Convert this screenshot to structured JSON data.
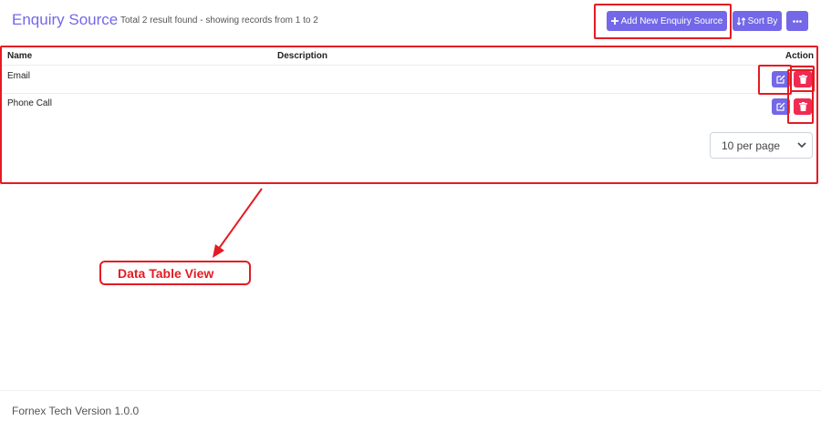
{
  "header": {
    "title": "Enquiry Source",
    "summary": "Total 2 result found - showing records from 1 to 2",
    "add_button": "Add New Enquiry Source",
    "sort_button": "Sort By"
  },
  "table": {
    "columns": [
      "Name",
      "Description",
      "Action"
    ],
    "rows": [
      {
        "name": "Email",
        "description": ""
      },
      {
        "name": "Phone Call",
        "description": ""
      }
    ]
  },
  "pagination": {
    "per_page": "10 per page"
  },
  "annotation": {
    "callout": "Data Table View"
  },
  "footer": {
    "version": "Fornex Tech Version 1.0.0"
  },
  "colors": {
    "accent": "#7468e8",
    "danger": "#f02b53",
    "annotation": "#e41b23"
  },
  "icons": [
    "plus-icon",
    "sort-icon",
    "ellipsis-icon",
    "edit-icon",
    "trash-icon",
    "chevron-down-icon"
  ]
}
